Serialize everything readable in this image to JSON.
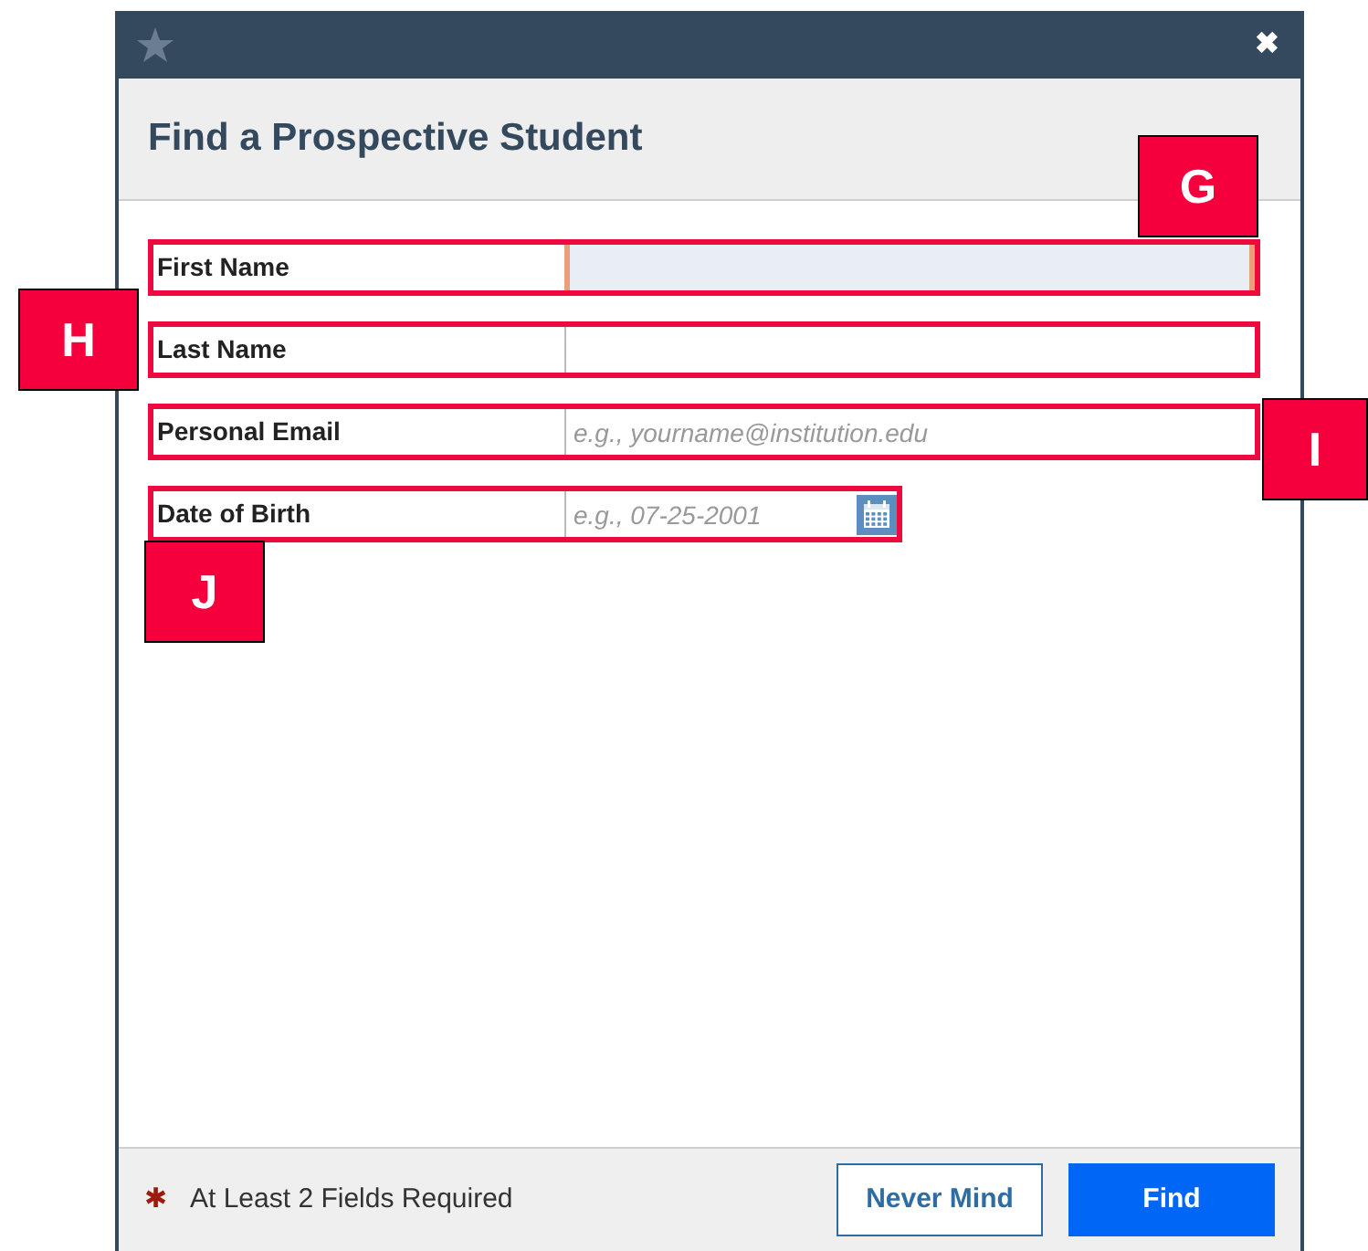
{
  "dialog": {
    "title": "Find a Prospective Student",
    "close": "✖"
  },
  "fields": [
    {
      "label": "First Name",
      "kind": "text",
      "focused": true
    },
    {
      "label": "Last Name",
      "kind": "text",
      "focused": false
    },
    {
      "label": "Personal Email",
      "kind": "text",
      "focused": false,
      "placeholder": "e.g., yourname@institution.edu"
    },
    {
      "label": "Date of Birth",
      "kind": "date",
      "focused": false,
      "placeholder": "e.g., 07-25-2001"
    }
  ],
  "callouts": [
    {
      "label": "G"
    },
    {
      "label": "H"
    },
    {
      "label": "I"
    },
    {
      "label": "J"
    }
  ],
  "footer": {
    "required_mark": "✱",
    "note": "At Least 2 Fields Required",
    "buttons": [
      {
        "label": "Never Mind",
        "kind": "secondary"
      },
      {
        "label": "Find",
        "kind": "primary"
      }
    ]
  }
}
